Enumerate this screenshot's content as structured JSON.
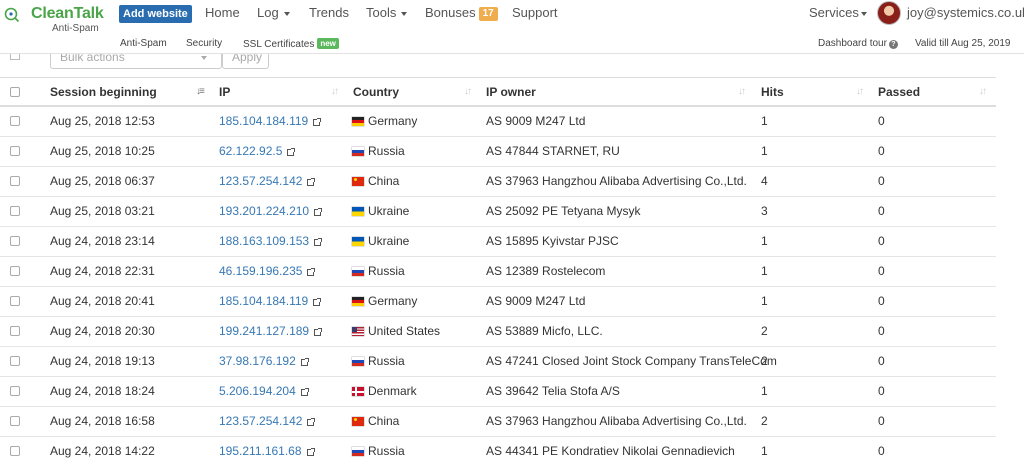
{
  "nav": {
    "logo_name": "CleanTalk",
    "logo_sub": "Anti-Spam",
    "add_website": "Add website",
    "home": "Home",
    "log": "Log",
    "trends": "Trends",
    "tools": "Tools",
    "bonuses": "Bonuses",
    "bonuses_count": "17",
    "support": "Support",
    "services": "Services",
    "user_email": "joy@systemics.co.uk"
  },
  "subnav": {
    "anti_spam": "Anti-Spam",
    "security": "Security",
    "ssl": "SSL Certificates",
    "ssl_badge": "new",
    "dashboard_tour": "Dashboard tour",
    "valid_till": "Valid till Aug 25, 2019"
  },
  "bulk": {
    "placeholder": "Bulk actions",
    "apply": "Apply"
  },
  "table": {
    "headers": {
      "session": "Session beginning",
      "ip": "IP",
      "country": "Country",
      "owner": "IP owner",
      "hits": "Hits",
      "passed": "Passed"
    },
    "rows": [
      {
        "session": "Aug 25, 2018 12:53",
        "ip": "185.104.184.119",
        "country": "Germany",
        "flag": "de",
        "owner": "AS 9009 M247 Ltd",
        "hits": "1",
        "passed": "0"
      },
      {
        "session": "Aug 25, 2018 10:25",
        "ip": "62.122.92.5",
        "country": "Russia",
        "flag": "ru",
        "owner": "AS 47844 STARNET, RU",
        "hits": "1",
        "passed": "0"
      },
      {
        "session": "Aug 25, 2018 06:37",
        "ip": "123.57.254.142",
        "country": "China",
        "flag": "cn",
        "owner": "AS 37963 Hangzhou Alibaba Advertising Co.,Ltd.",
        "hits": "4",
        "passed": "0"
      },
      {
        "session": "Aug 25, 2018 03:21",
        "ip": "193.201.224.210",
        "country": "Ukraine",
        "flag": "ua",
        "owner": "AS 25092 PE Tetyana Mysyk",
        "hits": "3",
        "passed": "0"
      },
      {
        "session": "Aug 24, 2018 23:14",
        "ip": "188.163.109.153",
        "country": "Ukraine",
        "flag": "ua",
        "owner": "AS 15895 Kyivstar PJSC",
        "hits": "1",
        "passed": "0"
      },
      {
        "session": "Aug 24, 2018 22:31",
        "ip": "46.159.196.235",
        "country": "Russia",
        "flag": "ru",
        "owner": "AS 12389 Rostelecom",
        "hits": "1",
        "passed": "0"
      },
      {
        "session": "Aug 24, 2018 20:41",
        "ip": "185.104.184.119",
        "country": "Germany",
        "flag": "de",
        "owner": "AS 9009 M247 Ltd",
        "hits": "1",
        "passed": "0"
      },
      {
        "session": "Aug 24, 2018 20:30",
        "ip": "199.241.127.189",
        "country": "United States",
        "flag": "us",
        "owner": "AS 53889 Micfo, LLC.",
        "hits": "2",
        "passed": "0"
      },
      {
        "session": "Aug 24, 2018 19:13",
        "ip": "37.98.176.192",
        "country": "Russia",
        "flag": "ru",
        "owner": "AS 47241 Closed Joint Stock Company TransTeleCom",
        "hits": "2",
        "passed": "0"
      },
      {
        "session": "Aug 24, 2018 18:24",
        "ip": "5.206.194.204",
        "country": "Denmark",
        "flag": "dk",
        "owner": "AS 39642 Telia Stofa A/S",
        "hits": "1",
        "passed": "0"
      },
      {
        "session": "Aug 24, 2018 16:58",
        "ip": "123.57.254.142",
        "country": "China",
        "flag": "cn",
        "owner": "AS 37963 Hangzhou Alibaba Advertising Co.,Ltd.",
        "hits": "2",
        "passed": "0"
      },
      {
        "session": "Aug 24, 2018 14:22",
        "ip": "195.211.161.68",
        "country": "Russia",
        "flag": "ru",
        "owner": "AS 44341 PE Kondratiev Nikolai Gennadievich",
        "hits": "1",
        "passed": "0"
      }
    ]
  }
}
